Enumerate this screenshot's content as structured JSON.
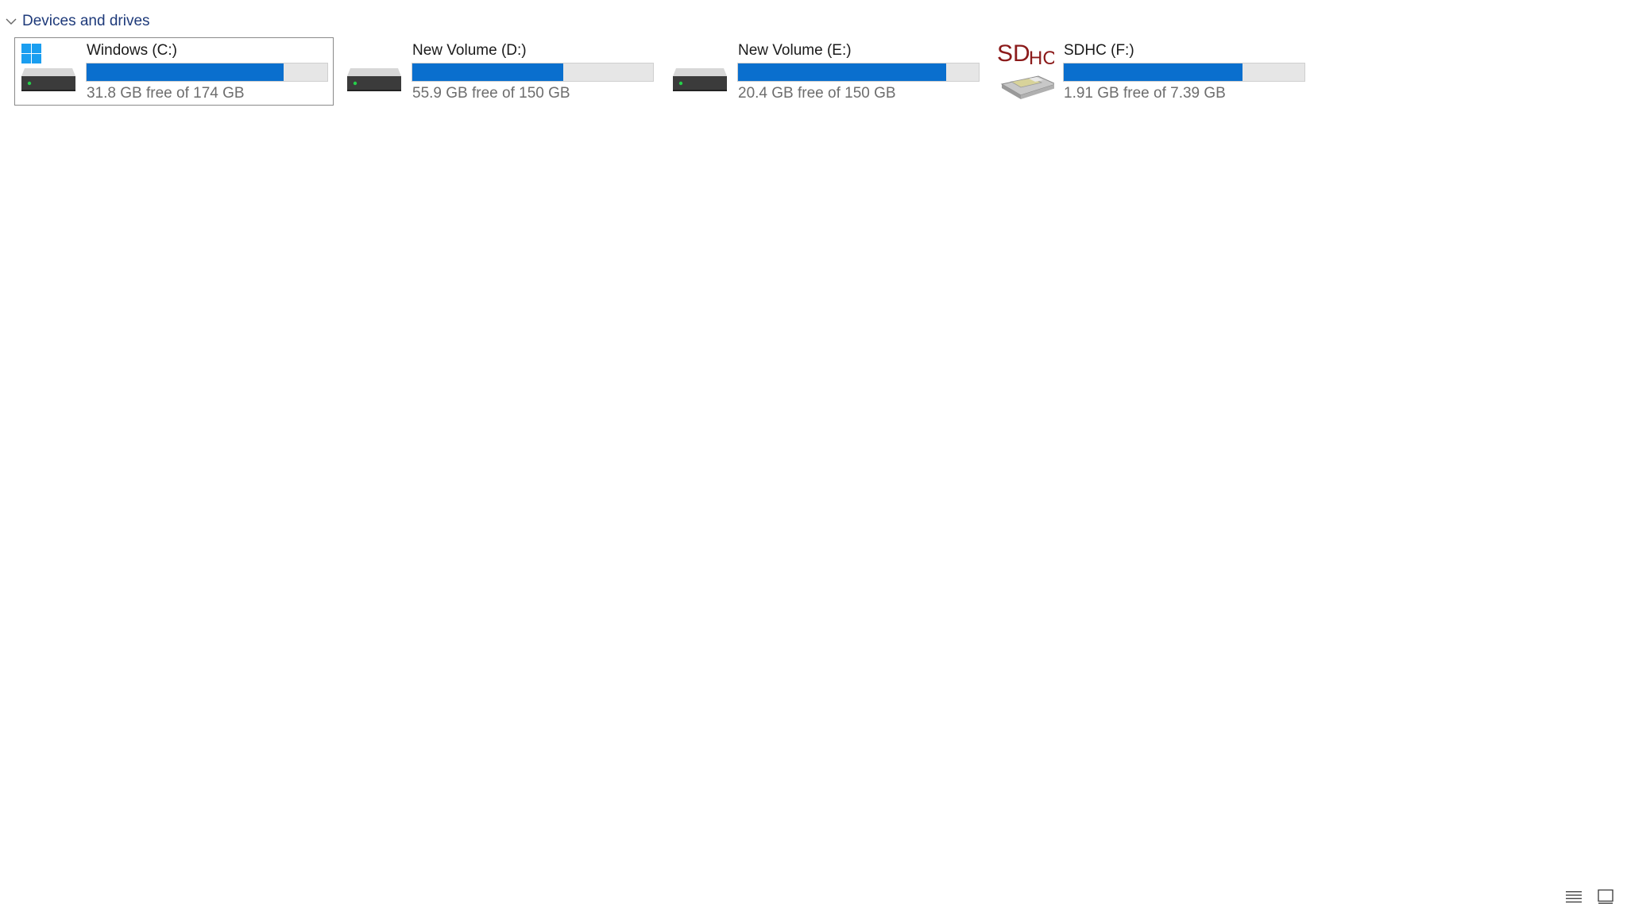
{
  "section": {
    "title": "Devices and drives"
  },
  "drives": [
    {
      "name": "Windows (C:)",
      "free_text": "31.8 GB free of 174 GB",
      "used_fraction": 0.817,
      "icon": "windows-system-drive-icon",
      "selected": true
    },
    {
      "name": "New Volume (D:)",
      "free_text": "55.9 GB free of 150 GB",
      "used_fraction": 0.627,
      "icon": "hard-drive-icon",
      "selected": false
    },
    {
      "name": "New Volume (E:)",
      "free_text": "20.4 GB free of 150 GB",
      "used_fraction": 0.864,
      "icon": "hard-drive-icon",
      "selected": false
    },
    {
      "name": "SDHC (F:)",
      "free_text": "1.91 GB free of 7.39 GB",
      "used_fraction": 0.742,
      "icon": "sdhc-card-icon",
      "icon_text_sd": "SD",
      "icon_text_hc": "HC",
      "selected": false
    }
  ],
  "colors": {
    "bar_fill": "#0a6fce",
    "bar_track": "#e6e6e6",
    "header_text": "#1e3a7a",
    "sdhc_logo": "#8b1a1a",
    "windows_logo": "#1a9ef0"
  },
  "view_buttons": [
    {
      "icon": "details-view-icon"
    },
    {
      "icon": "tiles-view-icon"
    }
  ]
}
